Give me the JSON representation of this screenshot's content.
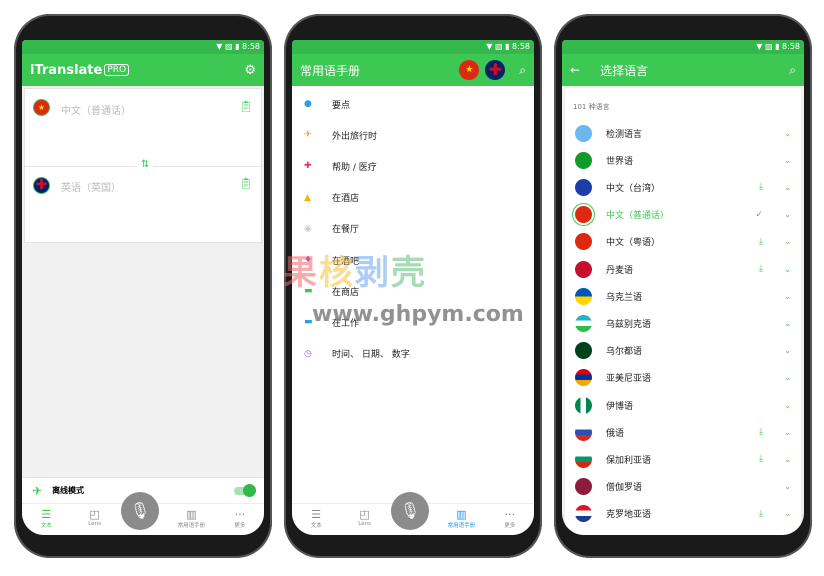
{
  "status": {
    "time": "8:58"
  },
  "screen1": {
    "title": "iTranslate",
    "badge": "PRO",
    "icon_settings": "gear-icon",
    "source_lang": "中文（普通话）",
    "target_lang": "英语（英国）",
    "offline_label": "离线模式",
    "offline_enabled": true
  },
  "nav": [
    {
      "label": "文本",
      "icon": "text-lines-icon"
    },
    {
      "label": "Lens",
      "icon": "camera-icon"
    },
    {
      "label": "常用语手册",
      "icon": "book-icon"
    },
    {
      "label": "更多",
      "icon": "more-icon"
    }
  ],
  "screen2": {
    "title": "常用语手册",
    "items": [
      "要点",
      "外出旅行时",
      "帮助 / 医疗",
      "在酒店",
      "在餐厅",
      "在酒吧",
      "在商店",
      "在工作",
      "时间、 日期、 数字"
    ]
  },
  "screen3": {
    "title": "选择语言",
    "count": "101 种语言",
    "languages": [
      {
        "name": "检测语言",
        "download": false
      },
      {
        "name": "世界语",
        "download": false
      },
      {
        "name": "中文（台湾）",
        "download": true
      },
      {
        "name": "中文（普通话）",
        "selected": true
      },
      {
        "name": "中文（粤语）",
        "download": true
      },
      {
        "name": "丹麦语",
        "download": true
      },
      {
        "name": "乌克兰语",
        "download": false
      },
      {
        "name": "乌兹别克语",
        "download": false
      },
      {
        "name": "乌尔都语",
        "download": false
      },
      {
        "name": "亚美尼亚语",
        "download": false
      },
      {
        "name": "伊博语",
        "download": false
      },
      {
        "name": "俄语",
        "download": true
      },
      {
        "name": "保加利亚语",
        "download": true
      },
      {
        "name": "僧伽罗语",
        "download": false
      },
      {
        "name": "克罗地亚语",
        "download": true
      }
    ]
  },
  "watermark": {
    "text": "果核剥壳",
    "url": "www.ghpym.com"
  },
  "colors": {
    "accent": "#3dc753",
    "active_tab": "#2196f3"
  }
}
